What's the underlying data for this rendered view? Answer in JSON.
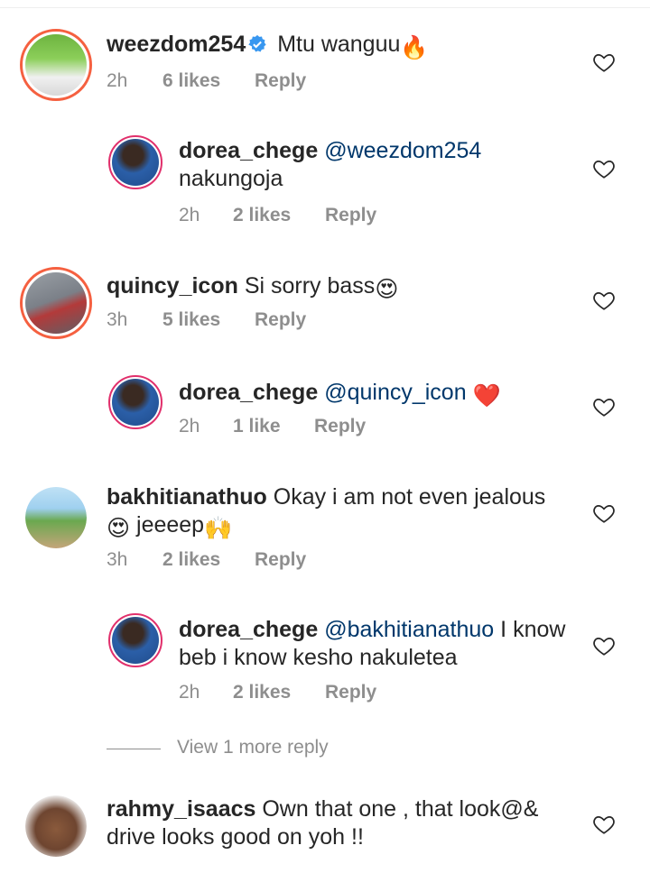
{
  "comments": [
    {
      "username": "weezdom254",
      "verified": true,
      "text": "Mtu wanguu",
      "emoji": "🔥",
      "time": "2h",
      "likes": "6 likes",
      "reply": "Reply"
    },
    {
      "username": "dorea_chege",
      "mention": "@weezdom254",
      "text": "nakungoja",
      "time": "2h",
      "likes": "2 likes",
      "reply": "Reply"
    },
    {
      "username": "quincy_icon",
      "text": "Si sorry bass",
      "emoji": "😍",
      "time": "3h",
      "likes": "5 likes",
      "reply": "Reply"
    },
    {
      "username": "dorea_chege",
      "mention": "@quincy_icon",
      "emoji": "❤️",
      "time": "2h",
      "likes": "1 like",
      "reply": "Reply"
    },
    {
      "username": "bakhitianathuo",
      "text_line1": "Okay i am not even jealous",
      "emoji1": "😍",
      "text_line2": "jeeeep",
      "emoji2": "🙌",
      "time": "3h",
      "likes": "2 likes",
      "reply": "Reply"
    },
    {
      "username": "dorea_chege",
      "mention": "@bakhitianathuo",
      "text_line1": "I know",
      "text_line2": "beb i know kesho nakuletea",
      "time": "2h",
      "likes": "2 likes",
      "reply": "Reply"
    },
    {
      "username": "rahmy_isaacs",
      "text_line1": "Own that one , that look@&",
      "text_line2": "drive looks good on yoh !!"
    }
  ],
  "view_more": "View 1 more reply",
  "colors": {
    "mention": "#00376b",
    "meta": "#8e8e8e",
    "verified": "#3897f0",
    "heart_outline": "#262626"
  },
  "icons": [
    "verified-badge-icon",
    "heart-icon"
  ]
}
